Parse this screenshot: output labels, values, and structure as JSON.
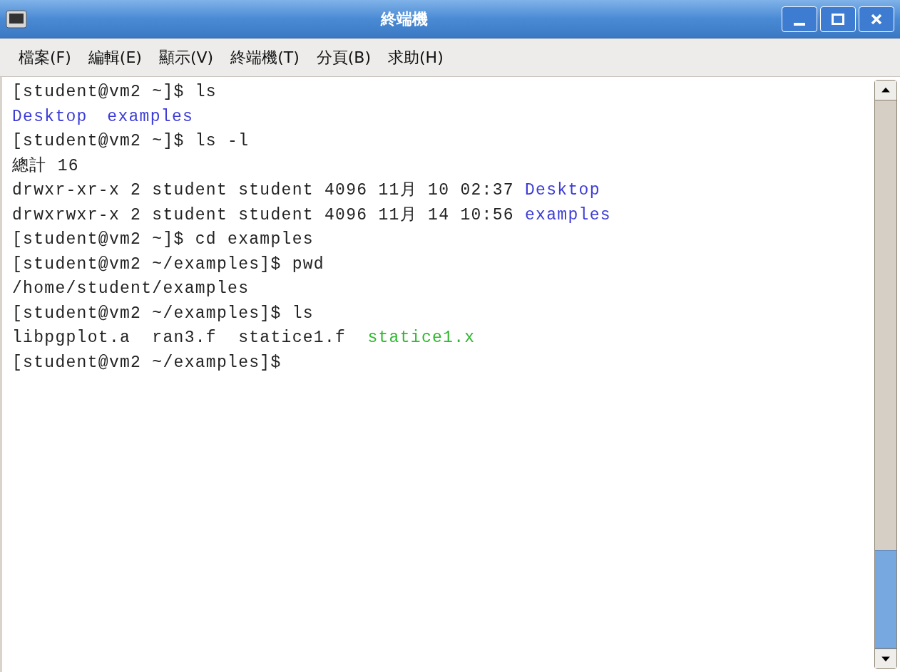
{
  "window": {
    "title": "終端機"
  },
  "menu": [
    "檔案(F)",
    "編輯(E)",
    "顯示(V)",
    "終端機(T)",
    "分頁(B)",
    "求助(H)"
  ],
  "terminal_lines": [
    [
      {
        "text": "[student@vm2 ~]$ ls",
        "kind": "plain"
      }
    ],
    [
      {
        "text": "Desktop",
        "kind": "directory"
      },
      {
        "text": "examples",
        "kind": "directory"
      }
    ],
    [
      {
        "text": "[student@vm2 ~]$ ls -l",
        "kind": "plain"
      }
    ],
    [
      {
        "text": "總計 16",
        "kind": "plain"
      }
    ],
    [
      {
        "text": "drwxr-xr-x 2 student student 4096 11月 10 02:37 ",
        "kind": "plain"
      },
      {
        "text": "Desktop",
        "kind": "directory"
      }
    ],
    [
      {
        "text": "drwxrwxr-x 2 student student 4096 11月 14 10:56 ",
        "kind": "plain"
      },
      {
        "text": "examples",
        "kind": "directory"
      }
    ],
    [
      {
        "text": "[student@vm2 ~]$ cd examples",
        "kind": "plain"
      }
    ],
    [
      {
        "text": "[student@vm2 ~/examples]$ pwd",
        "kind": "plain"
      }
    ],
    [
      {
        "text": "/home/student/examples",
        "kind": "plain"
      }
    ],
    [
      {
        "text": "[student@vm2 ~/examples]$ ls",
        "kind": "plain"
      }
    ],
    [
      {
        "text": "libpgplot.a  ran3.f  statice1.f  ",
        "kind": "plain"
      },
      {
        "text": "statice1.x",
        "kind": "executable"
      }
    ],
    [
      {
        "text": "[student@vm2 ~/examples]$",
        "kind": "plain"
      }
    ]
  ]
}
